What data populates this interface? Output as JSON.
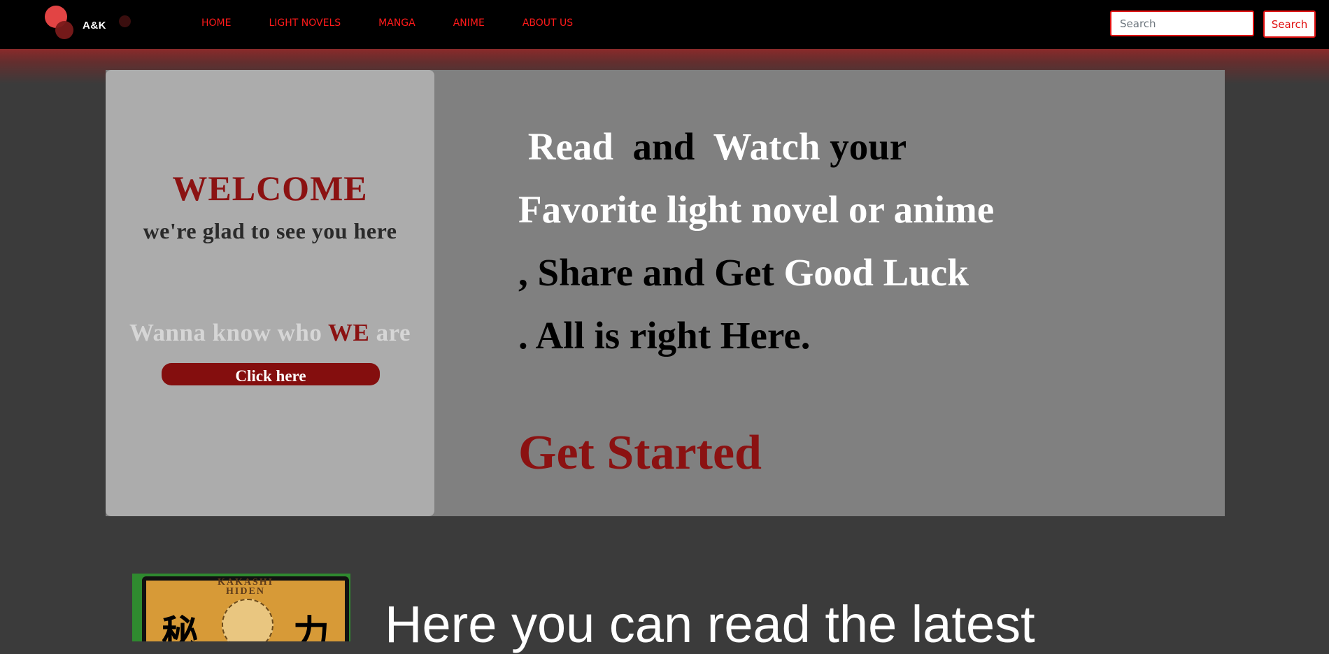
{
  "navbar": {
    "brand": "A&K",
    "links": [
      "HOME",
      "LIGHT NOVELS",
      "MANGA",
      "ANIME",
      "ABOUT US"
    ],
    "search_placeholder": "Search",
    "search_button": "Search"
  },
  "hero": {
    "welcome_title": "WELCOME",
    "welcome_sub": "we're glad to see you here",
    "wanna_pre": "Wanna know who ",
    "wanna_we": "WE",
    "wanna_post": " are",
    "click_button": "Click here",
    "tagline": {
      "line1": [
        " Read ",
        " and ",
        " Watch ",
        "your"
      ],
      "line2": [
        "Favorite light novel or anime"
      ],
      "line3": [
        ", Share and Get ",
        "Good Luck"
      ],
      "line4": [
        ". All is right Here."
      ]
    },
    "get_started": "Get Started"
  },
  "latest": {
    "cover_title_1": "KAKASHI",
    "cover_title_2": "HIDEN",
    "kanji_left": "秘",
    "kanji_right": "力",
    "heading": "Here you can read the latest"
  },
  "colors": {
    "accent_red": "#e01010",
    "dark_red": "#8b1212",
    "background": "#3b3b3b",
    "hero_gray": "#808080",
    "card_gray": "#acacac"
  }
}
